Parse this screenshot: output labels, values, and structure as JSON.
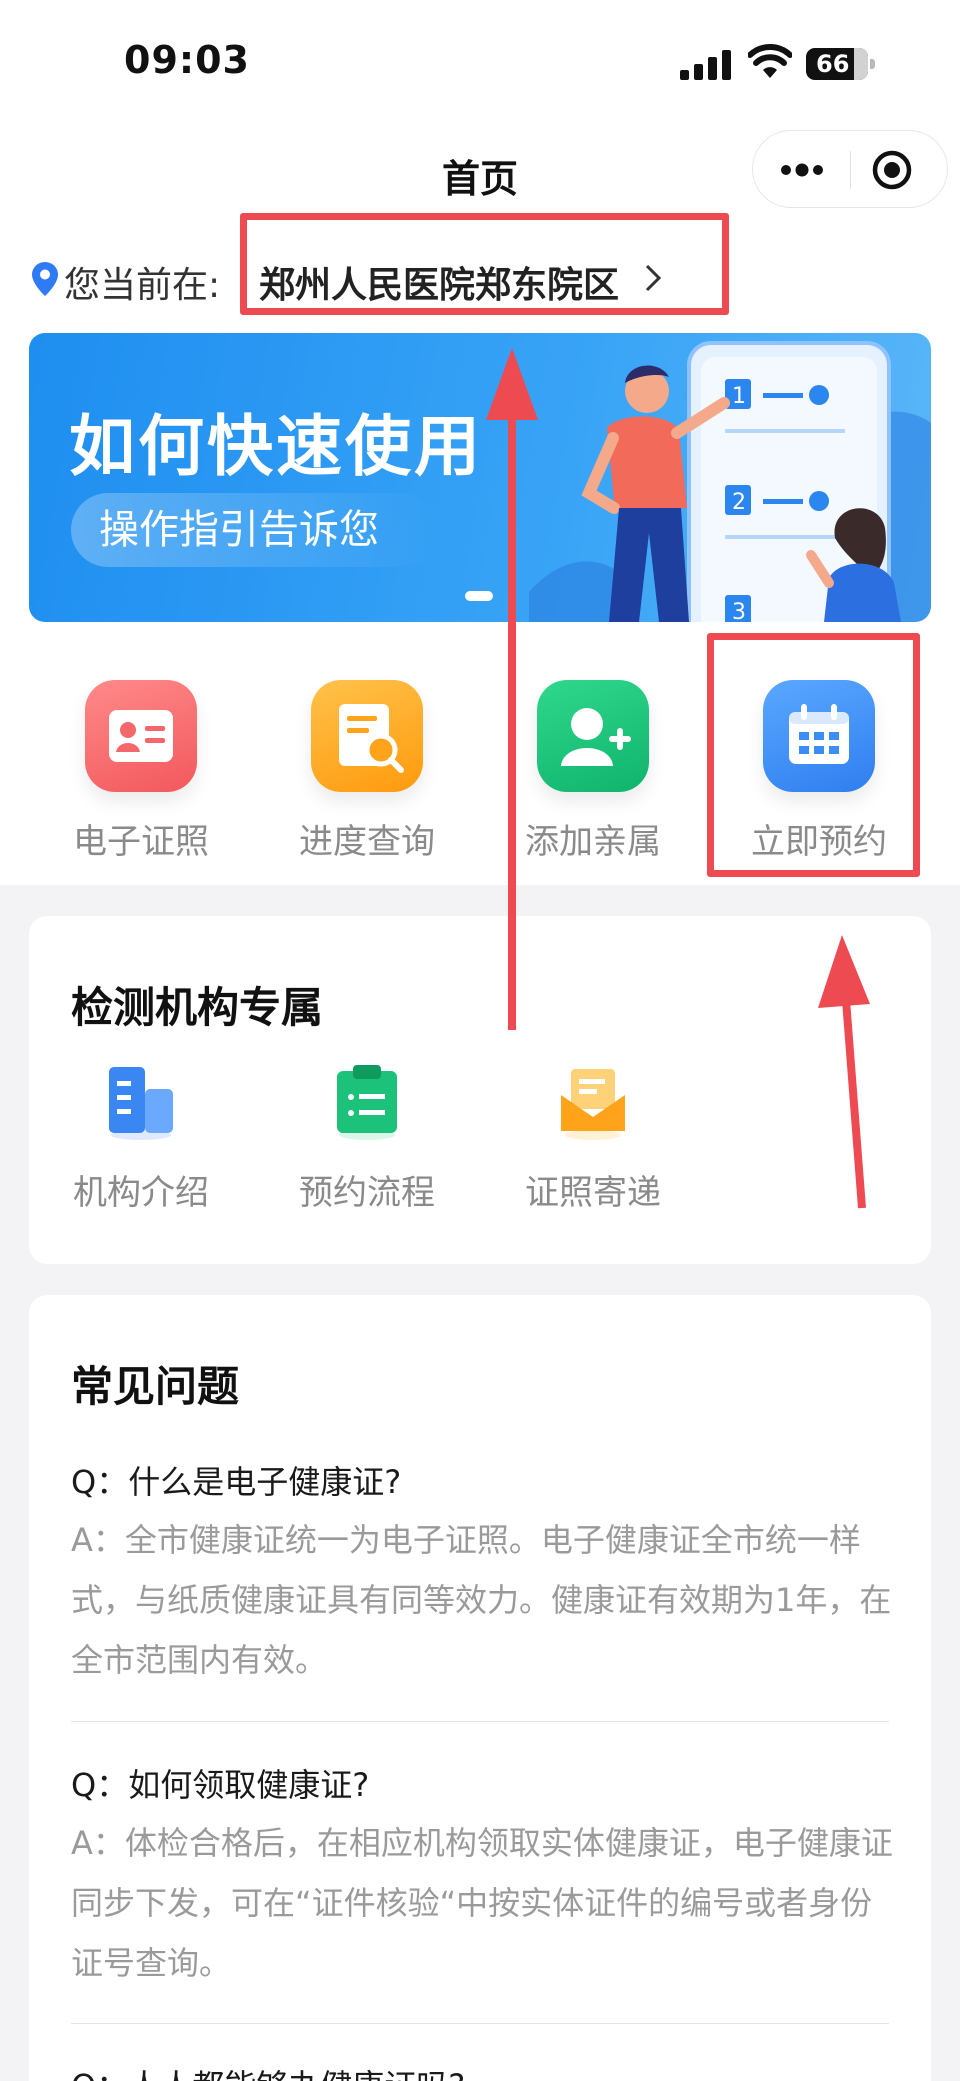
{
  "status_bar": {
    "time": "09:03",
    "battery": "66"
  },
  "nav": {
    "title": "首页"
  },
  "location": {
    "prefix": "您当前在:",
    "name": "郑州人民医院郑东院区"
  },
  "banner": {
    "title": "如何快速使用",
    "subtitle": "操作指引告诉您"
  },
  "quick_actions": [
    {
      "label": "电子证照",
      "icon": "id-card-icon",
      "color": "#f4676a"
    },
    {
      "label": "进度查询",
      "icon": "document-search-icon",
      "color": "#ffa31a"
    },
    {
      "label": "添加亲属",
      "icon": "add-user-icon",
      "color": "#1cc27a"
    },
    {
      "label": "立即预约",
      "icon": "calendar-icon",
      "color": "#3d8df5"
    }
  ],
  "agency_section": {
    "title": "检测机构专属",
    "items": [
      {
        "label": "机构介绍",
        "icon": "building-icon"
      },
      {
        "label": "预约流程",
        "icon": "clipboard-icon"
      },
      {
        "label": "证照寄递",
        "icon": "envelope-icon"
      }
    ]
  },
  "faq": {
    "title": "常见问题",
    "items": [
      {
        "q": "Q：什么是电子健康证?",
        "a": "A：全市健康证统一为电子证照。电子健康证全市统一样式，与纸质健康证具有同等效力。健康证有效期为1年，在全市范围内有效。"
      },
      {
        "q": "Q：如何领取健康证?",
        "a": "A：体检合格后，在相应机构领取实体健康证，电子健康证同步下发，可在“证件核验“中按实体证件的编号或者身份证号查询。"
      },
      {
        "q": "Q：人人都能够办健康证吗?",
        "a": ""
      }
    ]
  },
  "colors": {
    "highlight": "#ee4a51",
    "banner_blue": "#1e8ef0"
  }
}
